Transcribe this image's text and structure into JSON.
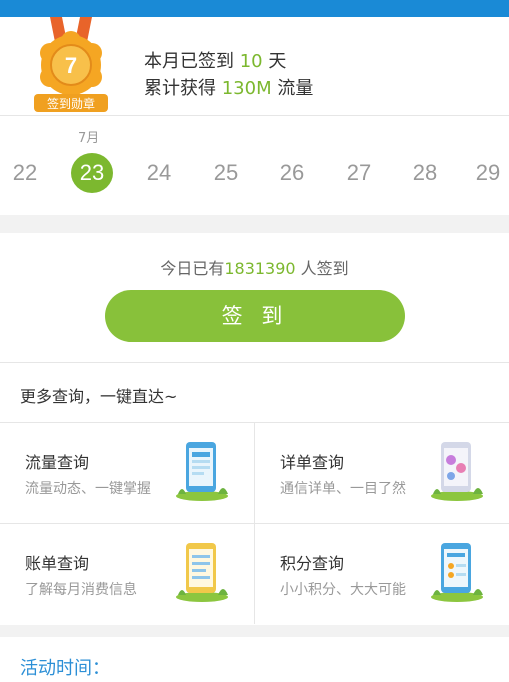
{
  "medal": {
    "number": "7",
    "label": "签到勋章"
  },
  "summary": {
    "line1_prefix": "本月已签到 ",
    "days": "10",
    "line1_suffix": " 天",
    "line2_prefix": "累计获得 ",
    "traffic": "130M",
    "line2_suffix": " 流量"
  },
  "calendar": {
    "month": "7月",
    "dates": [
      "22",
      "23",
      "24",
      "25",
      "26",
      "27",
      "28",
      "29"
    ],
    "selected": "23"
  },
  "checkin": {
    "today_prefix": "今日已有",
    "count": "1831390",
    "today_suffix": " 人签到",
    "button_label": "签 到"
  },
  "more": {
    "title": "更多查询，一键直达~"
  },
  "queries": [
    {
      "title": "流量查询",
      "subtitle": "流量动态、一键掌握"
    },
    {
      "title": "详单查询",
      "subtitle": "通信详单、一目了然"
    },
    {
      "title": "账单查询",
      "subtitle": "了解每月消费信息"
    },
    {
      "title": "积分查询",
      "subtitle": "小小积分、大大可能"
    }
  ],
  "activity": {
    "title": "活动时间："
  },
  "colors": {
    "accent": "#7cb82f",
    "button": "#88c13a",
    "link_blue": "#2c8fd6",
    "topbar": "#1a8ad6"
  }
}
